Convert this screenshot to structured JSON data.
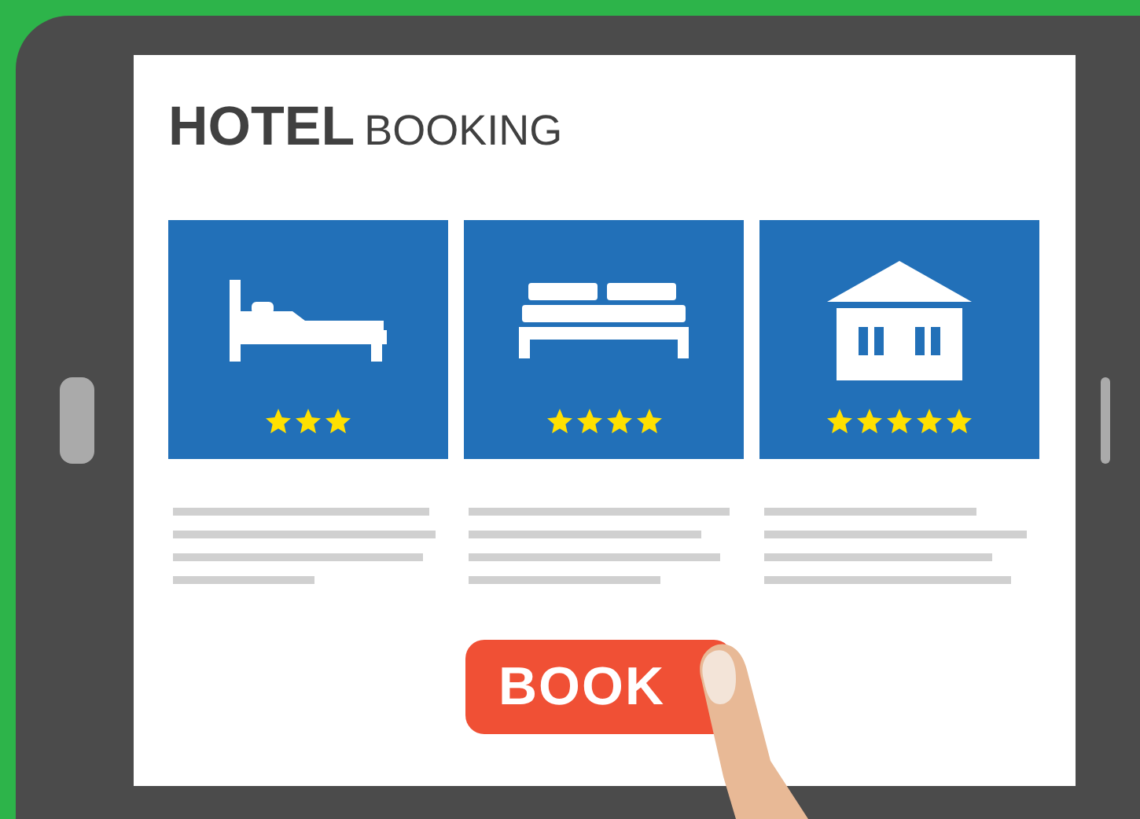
{
  "title": {
    "bold": "HOTEL",
    "regular": "BOOKING"
  },
  "hotels": [
    {
      "kind": "bed",
      "stars": 3
    },
    {
      "kind": "double-bed",
      "stars": 4
    },
    {
      "kind": "house",
      "stars": 5
    }
  ],
  "button": "BOOK"
}
